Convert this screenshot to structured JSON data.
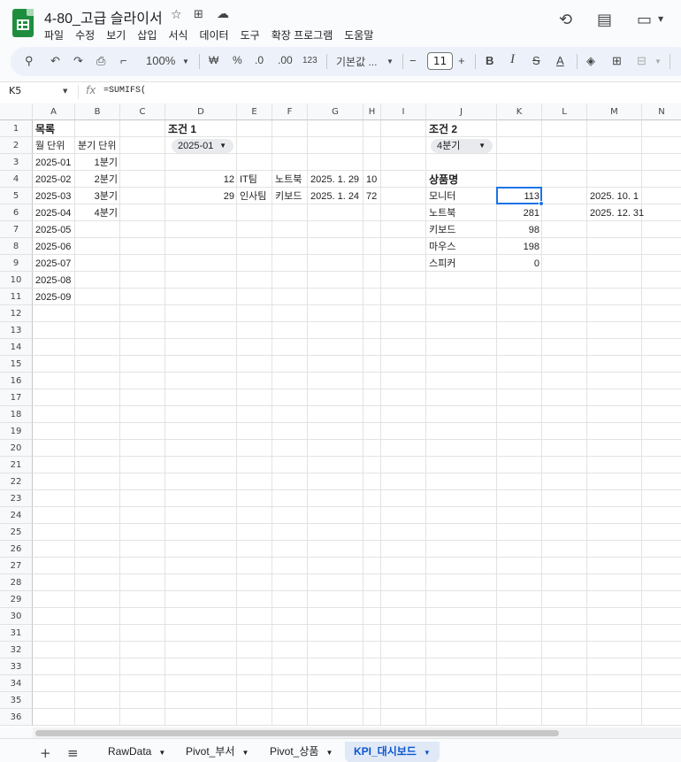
{
  "app": {
    "doc_title": "4-80_고급 슬라이서",
    "menu": [
      "파일",
      "수정",
      "보기",
      "삽입",
      "서식",
      "데이터",
      "도구",
      "확장 프로그램",
      "도움말"
    ]
  },
  "toolbar": {
    "zoom": "100%",
    "currency": "₩",
    "percent": "%",
    "dec_decrease": ".0",
    "dec_increase": ".00",
    "number_format": "123",
    "font": "기본값 ...",
    "font_size": "11",
    "minus": "−",
    "plus": "+",
    "bold": "B",
    "italic": "I",
    "strike": "S",
    "text_color": "A"
  },
  "formula_bar": {
    "cell_ref": "K5",
    "fx": "fx",
    "formula": "=SUMIFS("
  },
  "columns": [
    "A",
    "B",
    "C",
    "D",
    "E",
    "F",
    "G",
    "H",
    "I",
    "J",
    "K",
    "L",
    "M",
    "N"
  ],
  "rows": [
    "1",
    "2",
    "3",
    "4",
    "5",
    "6",
    "7",
    "8",
    "9",
    "10",
    "11",
    "12",
    "13",
    "14",
    "15",
    "16",
    "17",
    "18",
    "19",
    "20",
    "21",
    "22",
    "23",
    "24",
    "25",
    "26",
    "27",
    "28",
    "29",
    "30",
    "31",
    "32",
    "33",
    "34",
    "35",
    "36"
  ],
  "cells": {
    "A1": "목록",
    "A2": "월 단위",
    "B2": "분기 단위",
    "A3": "2025-01",
    "A4": "2025-02",
    "A5": "2025-03",
    "A6": "2025-04",
    "A7": "2025-05",
    "A8": "2025-06",
    "A9": "2025-07",
    "A10": "2025-08",
    "A11": "2025-09",
    "B3": "1분기",
    "B4": "2분기",
    "B5": "3분기",
    "B6": "4분기",
    "D1": "조건 1",
    "D2_chip": "2025-01",
    "D4": "12",
    "E4": "IT팀",
    "F4": "노트북",
    "G4": "2025. 1. 29",
    "H4": "10",
    "D5": "29",
    "E5": "인사팀",
    "F5": "키보드",
    "G5": "2025. 1. 24",
    "H5": "72",
    "J1": "조건 2",
    "J2_chip": "4분기",
    "J4": "상품명",
    "J5": "모니터",
    "J6": "노트북",
    "J7": "키보드",
    "J8": "마우스",
    "J9": "스피커",
    "K5": "113",
    "K6": "281",
    "K7": "98",
    "K8": "198",
    "K9": "0",
    "M5": "2025. 10. 1",
    "M6": "2025. 12. 31"
  },
  "sheet_tabs": [
    {
      "label": "RawData"
    },
    {
      "label": "Pivot_부서"
    },
    {
      "label": "Pivot_상품"
    },
    {
      "label": "KPI_대시보드"
    }
  ],
  "icons": {
    "add_sheet": "+",
    "all_sheets": "≡",
    "tab_caret": "▼"
  }
}
